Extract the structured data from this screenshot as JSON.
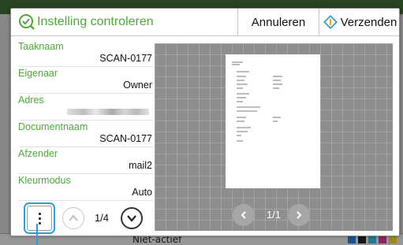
{
  "background": {
    "status_text": "Niet-actief"
  },
  "dialog": {
    "title": "Instelling controleren",
    "cancel_label": "Annuleren",
    "send_label": "Verzenden"
  },
  "fields": [
    {
      "label": "Taaknaam",
      "value": "SCAN-0177"
    },
    {
      "label": "Eigenaar",
      "value": "Owner"
    },
    {
      "label": "Adres",
      "value": ""
    },
    {
      "label": "Documentnaam",
      "value": "SCAN-0177"
    },
    {
      "label": "Afzender",
      "value": "mail2"
    },
    {
      "label": "Kleurmodus",
      "value": "Auto"
    }
  ],
  "info_pager": {
    "page_text": "1/4"
  },
  "preview": {
    "page_text": "1/1"
  },
  "colors": {
    "accent_green": "#4ea83a",
    "highlight_blue": "#2a9fd8"
  }
}
